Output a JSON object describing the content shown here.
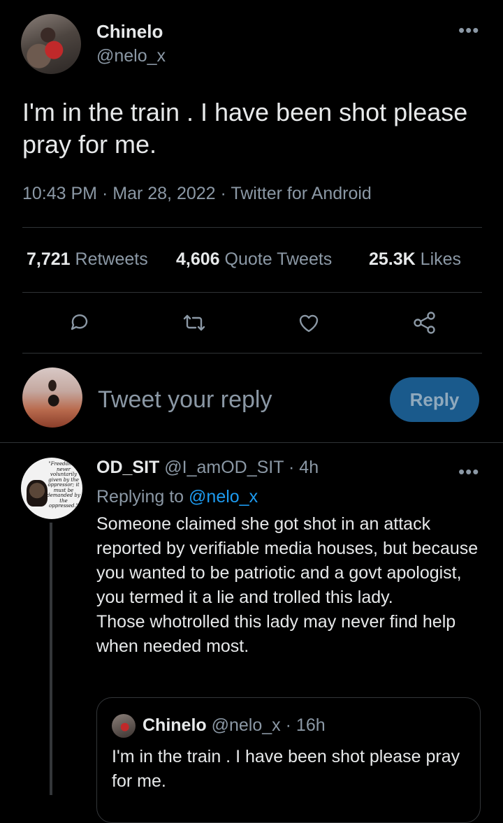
{
  "tweet": {
    "author_name": "Chinelo",
    "author_handle": "@nelo_x",
    "text": "I'm in the train .  I have been shot please pray for me.",
    "time": "10:43 PM",
    "date": "Mar 28, 2022",
    "source": "Twitter for Android",
    "more": "•••"
  },
  "stats": {
    "retweets_count": "7,721",
    "retweets_label": "Retweets",
    "quotes_count": "4,606",
    "quotes_label": "Quote Tweets",
    "likes_count": "25.3K",
    "likes_label": "Likes"
  },
  "actions": {
    "icons": [
      "comment-icon",
      "retweet-icon",
      "like-icon",
      "share-icon"
    ]
  },
  "reply_composer": {
    "placeholder": "Tweet your reply",
    "button_label": "Reply",
    "button_color": "#1a5a8c"
  },
  "reply": {
    "author_name": "OD_SIT",
    "author_handle": "@I_amOD_SIT",
    "age": "4h",
    "replying_prefix": "Replying to",
    "replying_to": "@nelo_x",
    "avatar_quote": "\"Freedom is never voluntarily given by the oppressor; it must be demanded by the oppressed.\"",
    "text_lines": [
      "Someone claimed she got shot in an attack reported by verifiable media houses, but because you wanted to be patriotic and a govt apologist, you termed it a lie and trolled this lady.",
      "Those whotrolled this lady may never find help when needed most."
    ],
    "more": "•••",
    "quoted": {
      "author_name": "Chinelo",
      "author_handle": "@nelo_x",
      "age": "16h",
      "text": "I'm in the train .  I have been shot please pray for me."
    }
  },
  "colors": {
    "background": "#000000",
    "text": "#e7e9ea",
    "muted": "#8b98a5",
    "link": "#1d9bf0",
    "divider": "#2f3336"
  }
}
